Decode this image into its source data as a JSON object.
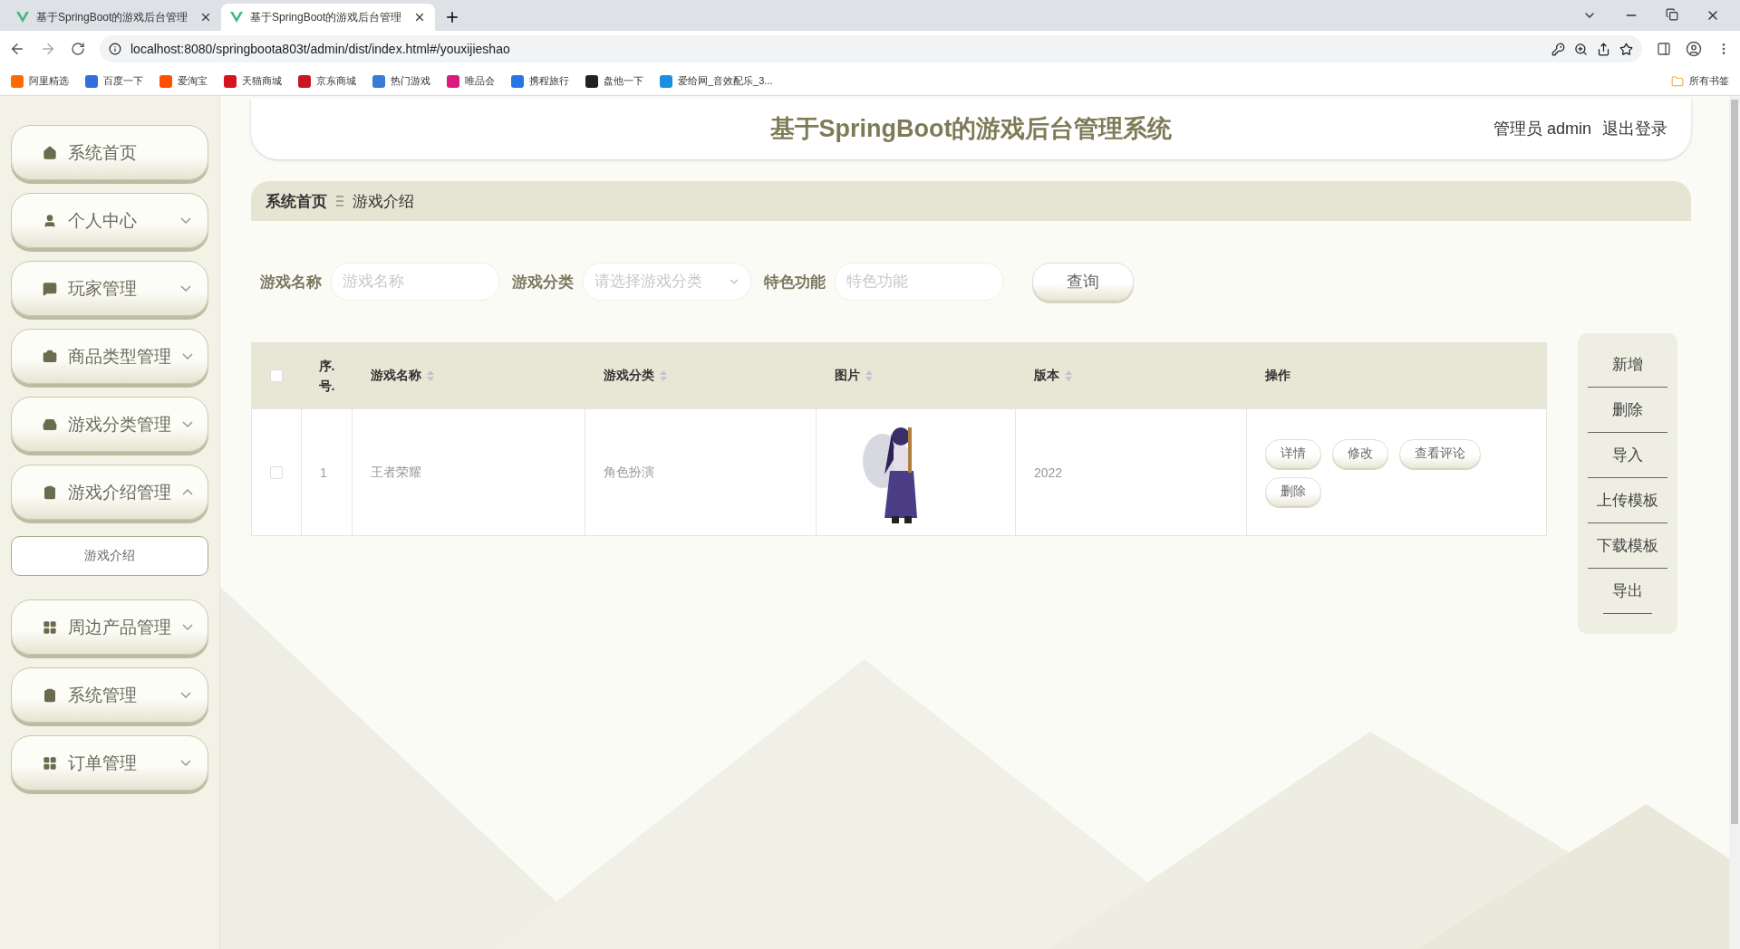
{
  "browser": {
    "tabs": [
      {
        "title": "基于SpringBoot的游戏后台管理",
        "selected": false
      },
      {
        "title": "基于SpringBoot的游戏后台管理",
        "selected": true
      }
    ],
    "url": "localhost:8080/springboota803t/admin/dist/index.html#/youxijieshao",
    "bookmarks": [
      {
        "label": "阿里精选",
        "color": "#ff6a00"
      },
      {
        "label": "百度一下",
        "color": "#2f6fe0"
      },
      {
        "label": "爱淘宝",
        "color": "#ff5000"
      },
      {
        "label": "天猫商城",
        "color": "#d4141e"
      },
      {
        "label": "京东商城",
        "color": "#c81623"
      },
      {
        "label": "热门游戏",
        "color": "#3a7bd5"
      },
      {
        "label": "唯品会",
        "color": "#d91b7f"
      },
      {
        "label": "携程旅行",
        "color": "#2577e3"
      },
      {
        "label": "盘他一下",
        "color": "#222222"
      },
      {
        "label": "爱给网_音效配乐_3...",
        "color": "#1a8fe0"
      }
    ],
    "bookmarks_folder": "所有书签"
  },
  "app": {
    "title": "基于SpringBoot的游戏后台管理系统",
    "user": "管理员 admin",
    "logout": "退出登录",
    "sidebar": [
      {
        "label": "系统首页"
      },
      {
        "label": "个人中心",
        "expanded": false
      },
      {
        "label": "玩家管理",
        "expanded": false
      },
      {
        "label": "商品类型管理",
        "expanded": false
      },
      {
        "label": "游戏分类管理",
        "expanded": false
      },
      {
        "label": "游戏介绍管理",
        "expanded": true,
        "children": [
          {
            "label": "游戏介绍"
          }
        ]
      },
      {
        "label": "周边产品管理",
        "expanded": false
      },
      {
        "label": "系统管理",
        "expanded": false
      },
      {
        "label": "订单管理",
        "expanded": false
      }
    ],
    "breadcrumb": [
      "系统首页",
      "游戏介绍"
    ],
    "search": {
      "fields": [
        {
          "label": "游戏名称",
          "placeholder": "游戏名称",
          "kind": "text"
        },
        {
          "label": "游戏分类",
          "placeholder": "请选择游戏分类",
          "kind": "select"
        },
        {
          "label": "特色功能",
          "placeholder": "特色功能",
          "kind": "text"
        }
      ],
      "button": "查询"
    },
    "table": {
      "header_checked": false,
      "columns": [
        {
          "label": "序.号.",
          "sortable": false
        },
        {
          "label": "游戏名称",
          "sortable": true
        },
        {
          "label": "游戏分类",
          "sortable": true
        },
        {
          "label": "图片",
          "sortable": true
        },
        {
          "label": "版本",
          "sortable": true
        },
        {
          "label": "操作",
          "sortable": false
        }
      ],
      "rows": [
        {
          "checked": false,
          "index": "1",
          "name": "王者荣耀",
          "category": "角色扮演",
          "version": "2022",
          "actions": [
            "详情",
            "修改",
            "查看评论",
            "删除"
          ]
        }
      ]
    },
    "actions": [
      "新增",
      "删除",
      "导入",
      "上传模板",
      "下载模板",
      "导出"
    ]
  }
}
